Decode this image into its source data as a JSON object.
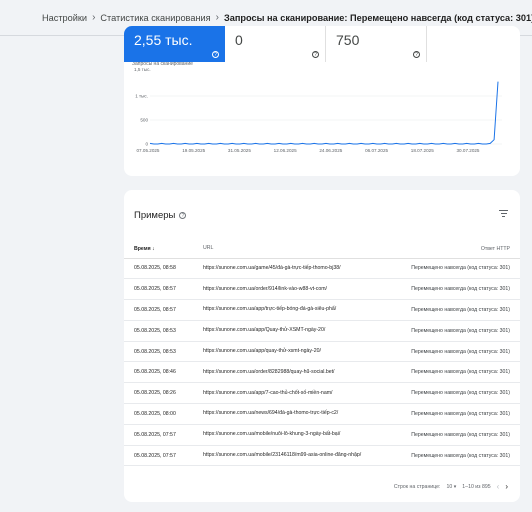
{
  "breadcrumb": {
    "items": [
      "Настройки",
      "Статистика сканирования"
    ],
    "current": "Запросы на сканирование: Перемещено навсегда (код статуса: 301)",
    "separator": "›"
  },
  "metrics": [
    {
      "value": "2,55 тыс."
    },
    {
      "value": "0"
    },
    {
      "value": "750"
    }
  ],
  "chart_data": {
    "type": "line",
    "title": "Запросы на сканирование",
    "x": [
      "07.05.2025",
      "19.05.2025",
      "31.05.2025",
      "12.06.2025",
      "24.06.2025",
      "06.07.2025",
      "18.07.2025",
      "30.07.2025"
    ],
    "y_ticks": [
      "1,5 тыс.",
      "1 тыс.",
      "500",
      "0"
    ],
    "ylim": [
      0,
      1500
    ],
    "series": [
      {
        "values": [
          0,
          0,
          0,
          0,
          0,
          0,
          0,
          0,
          0,
          0,
          0,
          0,
          0,
          0,
          0,
          0,
          0,
          0,
          0,
          0,
          0,
          0,
          0,
          0,
          0,
          0,
          0,
          0,
          0,
          0,
          0,
          0,
          0,
          0,
          0,
          0,
          0,
          0,
          0,
          0,
          0,
          0,
          0,
          0,
          0,
          0,
          0,
          0,
          0,
          0,
          0,
          0,
          0,
          0,
          0,
          0,
          0,
          0,
          0,
          0,
          0,
          0,
          0,
          0,
          0,
          0,
          0,
          0,
          0,
          0,
          0,
          0,
          0,
          0,
          0,
          0,
          0,
          0,
          0,
          0,
          0,
          0,
          0,
          0,
          0,
          0,
          0,
          0,
          90,
          1300
        ]
      }
    ],
    "color": "#1a73e8"
  },
  "examples": {
    "title": "Примеры",
    "columns": {
      "time": "Время",
      "url": "URL",
      "response": "Ответ HTTP"
    },
    "rows": [
      {
        "time": "05.08.2025, 08:58",
        "url": "https://sunone.com.ua/game/45/đá-gà-trực-tiếp-thomo-bj38/",
        "response": "Перемещено навсегда (код статуса: 301)"
      },
      {
        "time": "05.08.2025, 08:57",
        "url": "https://sunone.com.ua/order/914/link-vào-w88-vt-com/",
        "response": "Перемещено навсегда (код статуса: 301)"
      },
      {
        "time": "05.08.2025, 08:57",
        "url": "https://sunone.com.ua/app/trực-tiếp-bóng-đá-gà-siêu-phẩ/",
        "response": "Перемещено навсегда (код статуса: 301)"
      },
      {
        "time": "05.08.2025, 08:53",
        "url": "https://sunone.com.ua/app/Quay-thử-XSMT-ngày-20/",
        "response": "Перемещено навсегда (код статуса: 301)"
      },
      {
        "time": "05.08.2025, 08:53",
        "url": "https://sunone.com.ua/app/quay-thử-xsmt-ngày-20/",
        "response": "Перемещено навсегда (код статуса: 301)"
      },
      {
        "time": "05.08.2025, 08:46",
        "url": "https://sunone.com.ua/order/8282988/quay-hũ-social.bet/",
        "response": "Перемещено навсегда (код статуса: 301)"
      },
      {
        "time": "05.08.2025, 08:26",
        "url": "https://sunone.com.ua/app/7-cao-thủ-chốt-số-miền-nam/",
        "response": "Перемещено навсегда (код статуса: 301)"
      },
      {
        "time": "05.08.2025, 08:00",
        "url": "https://sunone.com.ua/news/694/đá-gà-thomo-trực-tiếp-c2/",
        "response": "Перемещено навсегда (код статуса: 301)"
      },
      {
        "time": "05.08.2025, 07:57",
        "url": "https://sunone.com.ua/mobile/nuôi-lô-khung-3-ngày-bất-bại/",
        "response": "Перемещено навсегда (код статуса: 301)"
      },
      {
        "time": "05.08.2025, 07:57",
        "url": "https://sunone.com.ua/mobile/23146118/m99-asia-online-đăng-nhập/",
        "response": "Перемещено навсегда (код статуса: 301)"
      }
    ]
  },
  "pagination": {
    "rows_label": "Строк на странице:",
    "rows_value": "10",
    "range": "1–10 из 895"
  }
}
